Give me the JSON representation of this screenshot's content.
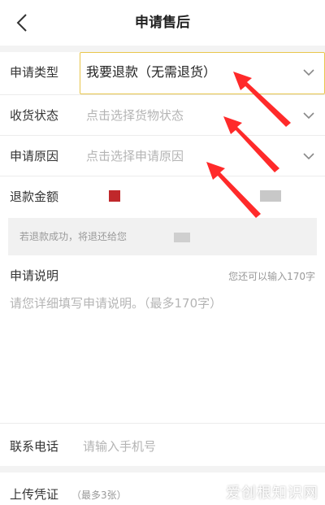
{
  "header": {
    "title": "申请售后",
    "back_icon": "chevron-left-icon"
  },
  "form": {
    "type": {
      "label": "申请类型",
      "value": "我要退款（无需退货）"
    },
    "goods": {
      "label": "收货状态",
      "placeholder": "点击选择货物状态"
    },
    "reason": {
      "label": "申请原因",
      "placeholder": "点击选择申请原因"
    },
    "amount": {
      "label": "退款金额"
    },
    "tip": "若退款成功，将退还给您",
    "description": {
      "label": "申请说明",
      "counter": "您还可以输入170字",
      "placeholder": "请您详细填写申请说明。（最多170字）"
    },
    "phone": {
      "label": "联系电话",
      "placeholder": "请输入手机号"
    },
    "upload": {
      "label": "上传凭证",
      "hint": "（最多3张）"
    }
  },
  "watermark": "爱创根知识网",
  "colors": {
    "highlight_border": "#e8c64c",
    "arrow": "#ff2a2a",
    "amount_mark": "#c0282b"
  }
}
